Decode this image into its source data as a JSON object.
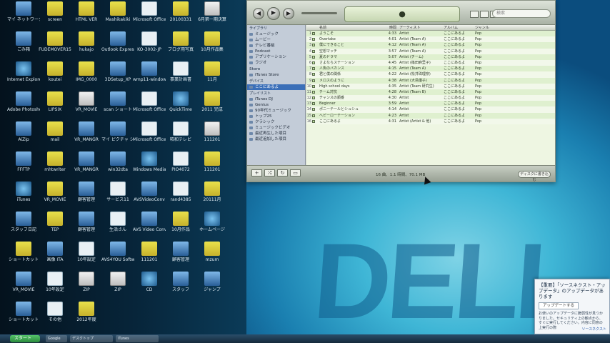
{
  "desktop": {
    "icons": [
      {
        "label": "マイ ネットワーク",
        "type": "app"
      },
      {
        "label": "screen",
        "type": "folder"
      },
      {
        "label": "HTML VER",
        "type": "folder"
      },
      {
        "label": "Mashikakiki",
        "type": "folder"
      },
      {
        "label": "Microsoft Office Excel 2007",
        "type": "doc"
      },
      {
        "label": "20100331",
        "type": "folder"
      },
      {
        "label": "6月第一期決算",
        "type": "zip"
      },
      {
        "label": "ごみ箱",
        "type": "app"
      },
      {
        "label": "FUDEMOVER15",
        "type": "folder"
      },
      {
        "label": "hukajo",
        "type": "folder"
      },
      {
        "label": "Outlook Express",
        "type": "app"
      },
      {
        "label": "KO-3002-JP",
        "type": "doc"
      },
      {
        "label": "ブログ用写真",
        "type": "folder"
      },
      {
        "label": "10月作品集",
        "type": "folder"
      },
      {
        "label": "Internet Explorer",
        "type": "round"
      },
      {
        "label": "koutei",
        "type": "folder"
      },
      {
        "label": "IMG_0000",
        "type": "folder"
      },
      {
        "label": "3DSetup_XP",
        "type": "app"
      },
      {
        "label": "wmp11-window",
        "type": "app"
      },
      {
        "label": "事業計画書",
        "type": "doc"
      },
      {
        "label": "11月",
        "type": "folder"
      },
      {
        "label": "Adobe Photoshop",
        "type": "app"
      },
      {
        "label": "LIPSIX",
        "type": "folder"
      },
      {
        "label": "VR_MOVIE",
        "type": "zip"
      },
      {
        "label": "scan ショート",
        "type": "app"
      },
      {
        "label": "Microsoft Office PowerPoint 2007",
        "type": "doc"
      },
      {
        "label": "QuickTime",
        "type": "round"
      },
      {
        "label": "2011 完成",
        "type": "folder"
      },
      {
        "label": "AiZip",
        "type": "app"
      },
      {
        "label": "mail",
        "type": "folder"
      },
      {
        "label": "VR_MANGR",
        "type": "app"
      },
      {
        "label": "マイ ピクチャ ショートカット",
        "type": "app"
      },
      {
        "label": "Microsoft Office Word 2007",
        "type": "doc"
      },
      {
        "label": "昭和テレビ",
        "type": "doc"
      },
      {
        "label": "111201",
        "type": "zip"
      },
      {
        "label": "FFFTP",
        "type": "app"
      },
      {
        "label": "mhtwriter",
        "type": "folder"
      },
      {
        "label": "VR_MANGR",
        "type": "app"
      },
      {
        "label": "win32dta",
        "type": "app"
      },
      {
        "label": "Windows Media Player",
        "type": "round"
      },
      {
        "label": "PIO4072",
        "type": "doc"
      },
      {
        "label": "111201",
        "type": "folder"
      },
      {
        "label": "iTunes",
        "type": "round"
      },
      {
        "label": "VR_MOVIE",
        "type": "folder"
      },
      {
        "label": "顧客管理",
        "type": "app"
      },
      {
        "label": "サービス11",
        "type": "doc"
      },
      {
        "label": "AVSVideoConv",
        "type": "app"
      },
      {
        "label": "rand4385",
        "type": "doc"
      },
      {
        "label": "20111月",
        "type": "folder"
      },
      {
        "label": "スタッフ日記",
        "type": "app"
      },
      {
        "label": "TEP",
        "type": "folder"
      },
      {
        "label": "顧客管理",
        "type": "app"
      },
      {
        "label": "生活さん",
        "type": "doc"
      },
      {
        "label": "AVS Video Converter",
        "type": "app"
      },
      {
        "label": "10月作品",
        "type": "folder"
      },
      {
        "label": "ホームページ",
        "type": "round"
      },
      {
        "label": "ショートカット",
        "type": "folder"
      },
      {
        "label": "画像 ITA",
        "type": "app"
      },
      {
        "label": "10年設定",
        "type": "doc"
      },
      {
        "label": "AVS4YOU Software",
        "type": "app"
      },
      {
        "label": "111201",
        "type": "folder"
      },
      {
        "label": "顧客管理",
        "type": "app"
      },
      {
        "label": "mzum",
        "type": "folder"
      },
      {
        "label": "VR_MOVIE",
        "type": "app"
      },
      {
        "label": "10年設定",
        "type": "doc"
      },
      {
        "label": "ZIP",
        "type": "zip"
      },
      {
        "label": "ZIP",
        "type": "zip"
      },
      {
        "label": "CD",
        "type": "round"
      },
      {
        "label": "スタッフ",
        "type": "app"
      },
      {
        "label": "ジャンプ",
        "type": "app"
      },
      {
        "label": "ショートカット",
        "type": "app"
      },
      {
        "label": "その他",
        "type": "doc"
      },
      {
        "label": "2012年度",
        "type": "folder"
      }
    ]
  },
  "itunes": {
    "now_playing": "",
    "search_placeholder": "検索",
    "sidebar": {
      "library_header": "ライブラリ",
      "library_items": [
        "ミュージック",
        "ムービー",
        "テレビ番組",
        "Podcast",
        "アプリケーション",
        "ラジオ"
      ],
      "store_header": "Store",
      "store_items": [
        "iTunes Store"
      ],
      "devices_header": "デバイス",
      "devices_items": [
        "ここにあるよ"
      ],
      "playlists_header": "プレイリスト",
      "playlists_items": [
        "iTunes DJ",
        "Genius",
        "90年代ミュージック",
        "トップ25",
        "クラシック",
        "ミュージックビデオ",
        "最近再生した項目",
        "最近追加した項目"
      ]
    },
    "columns": {
      "name": "名前",
      "time": "時間",
      "artist": "アーティスト",
      "album": "アルバム",
      "genre": "ジャンル"
    },
    "tracks": [
      {
        "num": "1",
        "name": "ようこそ",
        "time": "4:33",
        "artist": "Artist",
        "album": "ここにあるよ",
        "genre": "Pop"
      },
      {
        "num": "2",
        "name": "Overtake",
        "time": "4:01",
        "artist": "Artist (Team A)",
        "album": "ここにあるよ",
        "genre": "Pop"
      },
      {
        "num": "3",
        "name": "僕にできること",
        "time": "4:12",
        "artist": "Artist (Team A)",
        "album": "ここにあるよ",
        "genre": "Pop"
      },
      {
        "num": "4",
        "name": "空想マッチ",
        "time": "3:57",
        "artist": "Artist (Team A)",
        "album": "ここにあるよ",
        "genre": "Pop"
      },
      {
        "num": "5",
        "name": "夏のドラマ",
        "time": "5:07",
        "artist": "Artist (チーム)",
        "album": "ここにあるよ",
        "genre": "Pop"
      },
      {
        "num": "6",
        "name": "さよならステーション",
        "time": "4:45",
        "artist": "Artist (篠田麻里子)",
        "album": "ここにあるよ",
        "genre": "Pop"
      },
      {
        "num": "7",
        "name": "人魚のバカンス",
        "time": "4:15",
        "artist": "Artist (Team A)",
        "album": "ここにあるよ",
        "genre": "Pop"
      },
      {
        "num": "8",
        "name": "君と僕の関係",
        "time": "4:22",
        "artist": "Artist (松井珠理奈)",
        "album": "ここにあるよ",
        "genre": "Pop"
      },
      {
        "num": "9",
        "name": "メロスのように",
        "time": "4:38",
        "artist": "Artist (大島優子)",
        "album": "ここにあるよ",
        "genre": "Pop"
      },
      {
        "num": "10",
        "name": "High school days",
        "time": "4:35",
        "artist": "Artist (Team 研究生)",
        "album": "ここにあるよ",
        "genre": "Pop"
      },
      {
        "num": "11",
        "name": "チーム対抗",
        "time": "4:28",
        "artist": "Artist (Team B)",
        "album": "ここにあるよ",
        "genre": "Pop"
      },
      {
        "num": "12",
        "name": "チャンスの順番",
        "time": "4:30",
        "artist": "Artist",
        "album": "ここにあるよ",
        "genre": "Pop"
      },
      {
        "num": "13",
        "name": "Beginner",
        "time": "3:59",
        "artist": "Artist",
        "album": "ここにあるよ",
        "genre": "Pop"
      },
      {
        "num": "14",
        "name": "ポニーテールとシュシュ",
        "time": "4:14",
        "artist": "Artist",
        "album": "ここにあるよ",
        "genre": "Pop"
      },
      {
        "num": "15",
        "name": "ヘビーローテーション",
        "time": "4:23",
        "artist": "Artist",
        "album": "ここにあるよ",
        "genre": "Pop"
      },
      {
        "num": "16",
        "name": "ここにあるよ",
        "time": "4:31",
        "artist": "Artist (Artist & 他)",
        "album": "ここにあるよ",
        "genre": "Pop"
      }
    ],
    "status": "16 曲、1.1 時間、70.1 MB",
    "burn_label": "ディスクに書き込む"
  },
  "taskbar": {
    "start_label": "スタート",
    "items": [
      "Google",
      "デスクトップ",
      "iTunes"
    ]
  },
  "popup": {
    "title": "【重要】「ソースネクスト・アップデータ」のアップデータがあります",
    "button": "アップデートする",
    "body": "お使いのアップデータに脆弱性が見つかりました。セキュリティ上の観点から、すぐに実行してください。内容に同意の上実行の際",
    "link": "ソースネクスト"
  },
  "wallpaper": {
    "logo_text": "DELL"
  },
  "colors": {
    "accent": "#3b6fb8",
    "lcd": "#d6e6c4",
    "list_odd": "#dff0cf"
  }
}
